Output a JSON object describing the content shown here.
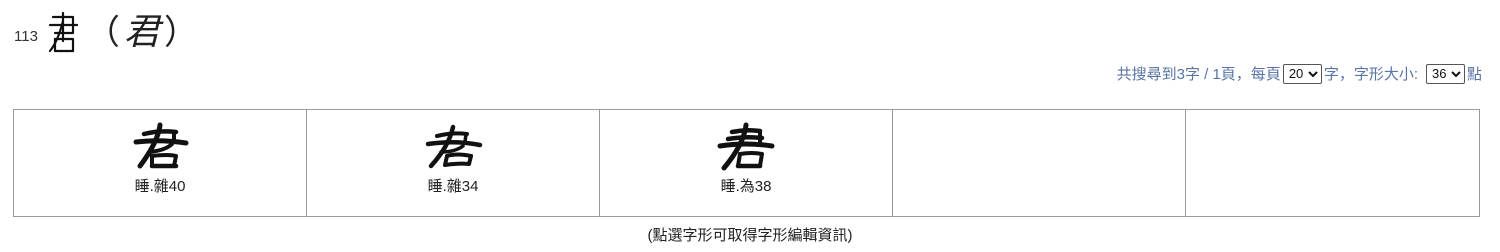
{
  "header": {
    "entry_number": "113",
    "paren_open": "（",
    "modern_char": "君",
    "paren_close": "）"
  },
  "search": {
    "summary_prefix": "共搜尋到3字 / 1頁，每頁",
    "per_page_value": "20",
    "per_page_suffix": "字，字形大小:",
    "size_value": "36",
    "size_suffix": "點"
  },
  "glyphs": [
    {
      "label": "睡.雜40",
      "icon": "jun-brush-glyph-1"
    },
    {
      "label": "睡.雜34",
      "icon": "jun-brush-glyph-2"
    },
    {
      "label": "睡.為38",
      "icon": "jun-brush-glyph-3"
    },
    {
      "label": ""
    },
    {
      "label": ""
    }
  ],
  "footer": {
    "note": "(點選字形可取得字形編輯資訊)"
  },
  "colors": {
    "info_text": "#5a74a6",
    "grid_border": "#9a9a9a"
  }
}
